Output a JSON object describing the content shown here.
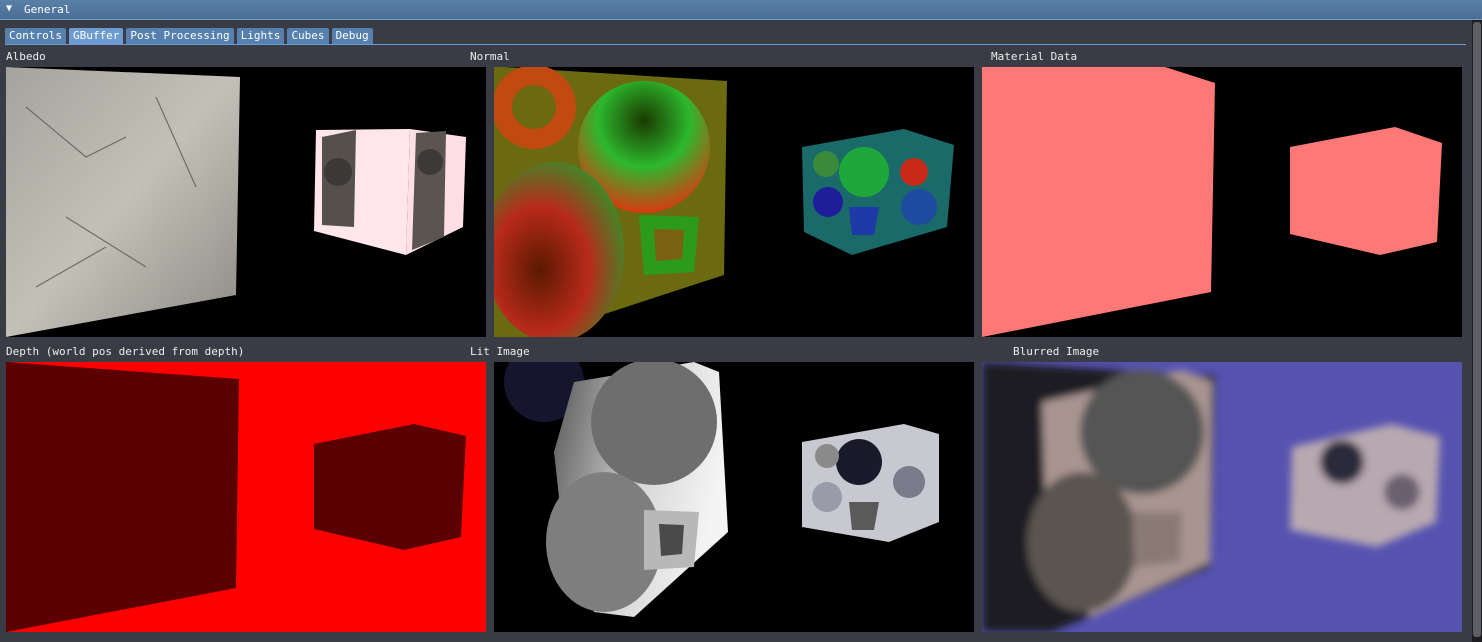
{
  "window": {
    "title": "General",
    "collapse_icon": "triangle-down-icon"
  },
  "tabs": [
    {
      "label": "Controls"
    },
    {
      "label": "GBuffer",
      "active": true
    },
    {
      "label": "Post Processing"
    },
    {
      "label": "Lights"
    },
    {
      "label": "Cubes"
    },
    {
      "label": "Debug"
    }
  ],
  "panels": {
    "albedo": {
      "label": "Albedo"
    },
    "normal": {
      "label": "Normal"
    },
    "material": {
      "label": "Material Data"
    },
    "depth": {
      "label": "Depth (world pos derived from depth)"
    },
    "lit": {
      "label": "Lit Image"
    },
    "blurred": {
      "label": "Blurred Image"
    }
  },
  "colors": {
    "tab": "#5580b0",
    "tab_active": "#6b9bd0",
    "material": "#ff7878",
    "depth_bg": "#ff0000",
    "depth_near": "#5a0000",
    "blur_bg": "#5653b0"
  }
}
